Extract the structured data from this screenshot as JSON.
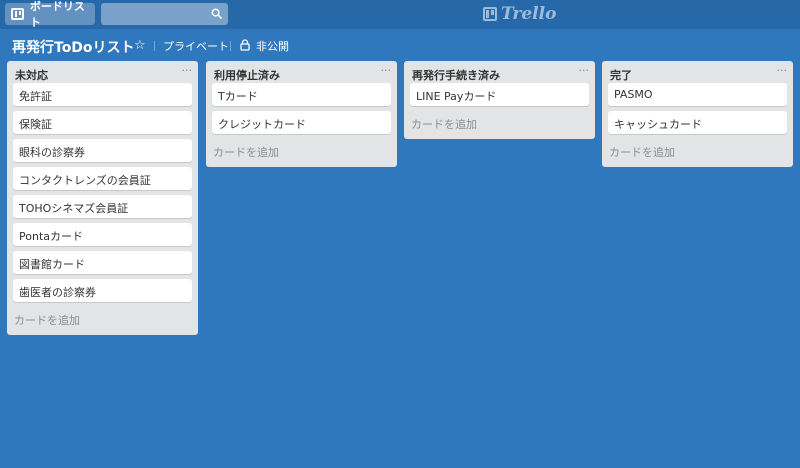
{
  "header": {
    "boards_button_label": "ボードリスト",
    "search": {
      "value": "",
      "placeholder": ""
    },
    "logo_text": "Trello"
  },
  "board": {
    "title": "再発行ToDoリスト",
    "privacy_label": "プライベート",
    "visibility_label": "非公開"
  },
  "lists": [
    {
      "title": "未対応",
      "menu": "···",
      "cards": [
        "免許証",
        "保険証",
        "眼科の診察券",
        "コンタクトレンズの会員証",
        "TOHOシネマズ会員証",
        "Pontaカード",
        "図書館カード",
        "歯医者の診察券"
      ],
      "add_label": "カードを追加"
    },
    {
      "title": "利用停止済み",
      "menu": "···",
      "cards": [
        "Tカード",
        "クレジットカード"
      ],
      "add_label": "カードを追加"
    },
    {
      "title": "再発行手続き済み",
      "menu": "···",
      "cards": [
        "LINE Payカード"
      ],
      "add_label": "カードを追加"
    },
    {
      "title": "完了",
      "menu": "···",
      "cards": [
        "PASMO",
        "キャッシュカード"
      ],
      "add_label": "カードを追加"
    }
  ],
  "colors": {
    "board_background": "#2f78bd",
    "header_background": "#2768a8",
    "list_background": "#e2e4e6",
    "card_background": "#ffffff"
  },
  "icons": {
    "boards": "boards-icon",
    "search": "search-icon",
    "star": "star-icon",
    "lock": "lock-icon",
    "logo": "trello-logo-icon"
  }
}
